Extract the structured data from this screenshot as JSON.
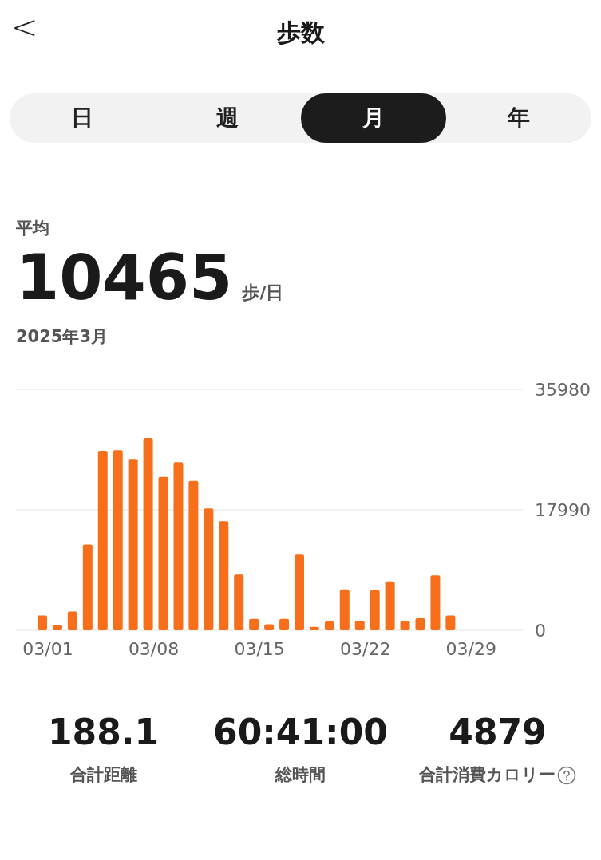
{
  "header": {
    "back": "<",
    "title": "歩数"
  },
  "tabs": [
    {
      "label": "日",
      "selected": false
    },
    {
      "label": "週",
      "selected": false
    },
    {
      "label": "月",
      "selected": true
    },
    {
      "label": "年",
      "selected": false
    }
  ],
  "summary": {
    "label": "平均",
    "value": "10465",
    "unit": "歩/日",
    "period": "2025年3月"
  },
  "chart_data": {
    "type": "bar",
    "categories": [
      "03/01",
      null,
      null,
      null,
      null,
      null,
      null,
      "03/08",
      null,
      null,
      null,
      null,
      null,
      null,
      "03/15",
      null,
      null,
      null,
      null,
      null,
      null,
      "03/22",
      null,
      null,
      null,
      null,
      null,
      null,
      "03/29",
      null,
      null
    ],
    "series": [
      {
        "color": "#f76e1b",
        "values": [
          2200,
          800,
          2800,
          12800,
          26800,
          26900,
          25600,
          28700,
          22900,
          25100,
          22300,
          18200,
          16300,
          8300,
          1700,
          900,
          1700,
          11300,
          500,
          1300,
          6100,
          1400,
          6000,
          7300,
          1400,
          1800,
          8200,
          2200,
          null,
          null,
          null
        ]
      }
    ],
    "ylim": [
      0,
      35980
    ],
    "yticks": [
      0,
      17990,
      35980
    ]
  },
  "stats": [
    {
      "value": "188.1",
      "label": "合計距離",
      "help": false
    },
    {
      "value": "60:41:00",
      "label": "総時間",
      "help": false
    },
    {
      "value": "4879",
      "label": "合計消費カロリー",
      "help": true
    }
  ]
}
